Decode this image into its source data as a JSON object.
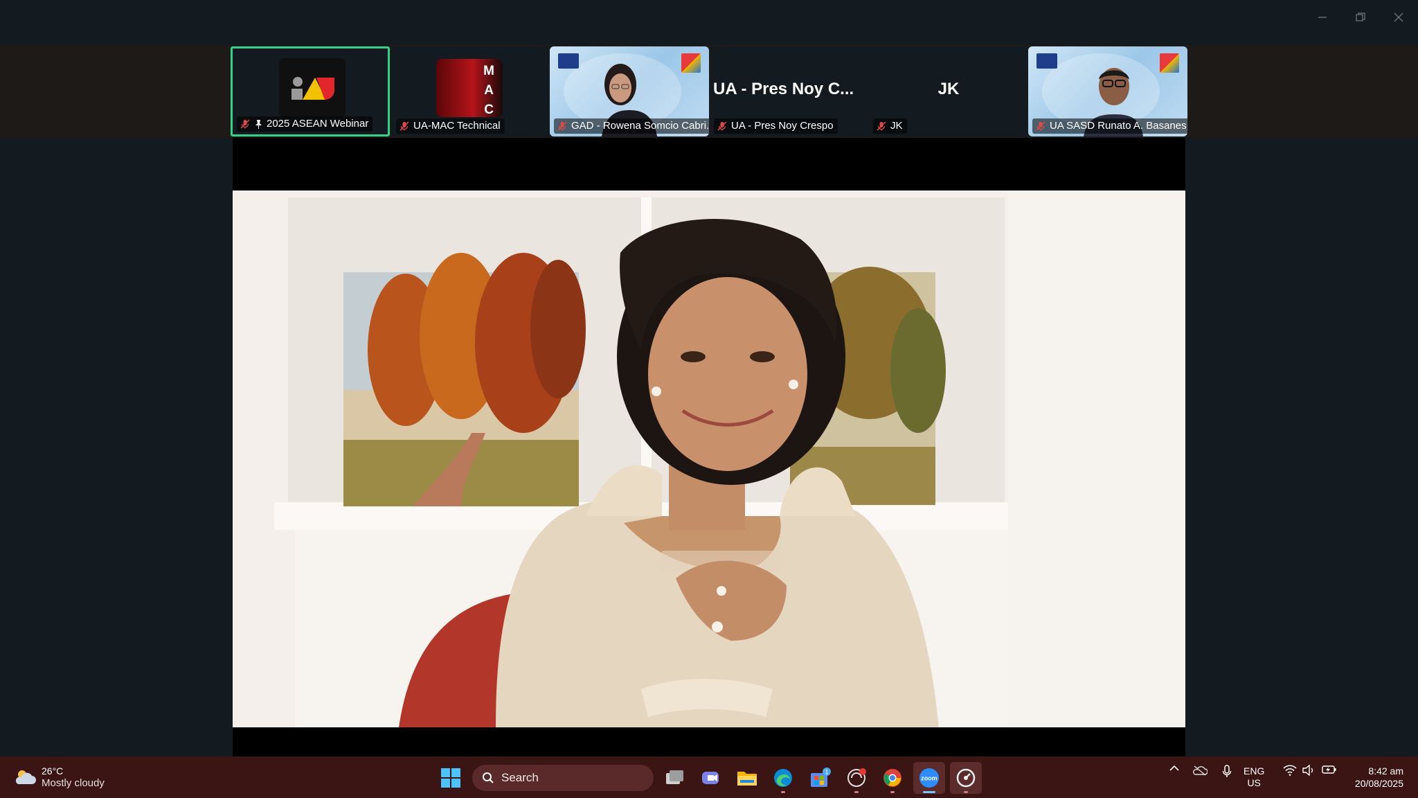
{
  "window": {
    "controls": [
      "minimize",
      "restore",
      "close"
    ]
  },
  "participants": [
    {
      "name": "2025 ASEAN Webinar",
      "muted": true,
      "pinned": true,
      "active_speaker": true
    },
    {
      "name": "UA-MAC Technical",
      "muted": true,
      "logo_letters": [
        "M",
        "A",
        "C"
      ]
    },
    {
      "name": "GAD - Rowena Somcio Cabri...",
      "muted": true
    },
    {
      "name": "UA - Pres Noy Crespo",
      "display_name": "UA - Pres Noy C...",
      "muted": true
    },
    {
      "name": "JK",
      "display_name": "JK",
      "muted": true
    },
    {
      "name": "UA SASD Runato A. Basanes",
      "muted": true
    }
  ],
  "colors": {
    "active_border": "#2fd38a",
    "mic_muted": "#e0484a",
    "taskbar_bg": "#3b1414",
    "app_bg": "#141b20"
  },
  "taskbar": {
    "weather": {
      "temp": "26°C",
      "condition": "Mostly cloudy",
      "icon": "cloudy-icon"
    },
    "search_label": "Search",
    "apps": [
      {
        "name": "start",
        "icon": "windows-icon"
      },
      {
        "name": "task-view",
        "icon": "task-view-icon"
      },
      {
        "name": "teams",
        "icon": "teams-icon"
      },
      {
        "name": "file-explorer",
        "icon": "folder-icon"
      },
      {
        "name": "edge",
        "icon": "edge-icon"
      },
      {
        "name": "store",
        "icon": "store-icon",
        "badge": "1"
      },
      {
        "name": "app-6",
        "icon": "circle-app-icon"
      },
      {
        "name": "chrome",
        "icon": "chrome-icon"
      },
      {
        "name": "zoom",
        "icon": "zoom-icon",
        "label": "zoom"
      },
      {
        "name": "app-9",
        "icon": "gauge-icon"
      }
    ],
    "language": {
      "line1": "ENG",
      "line2": "US"
    },
    "time": "8:42 am",
    "date": "20/08/2025"
  }
}
